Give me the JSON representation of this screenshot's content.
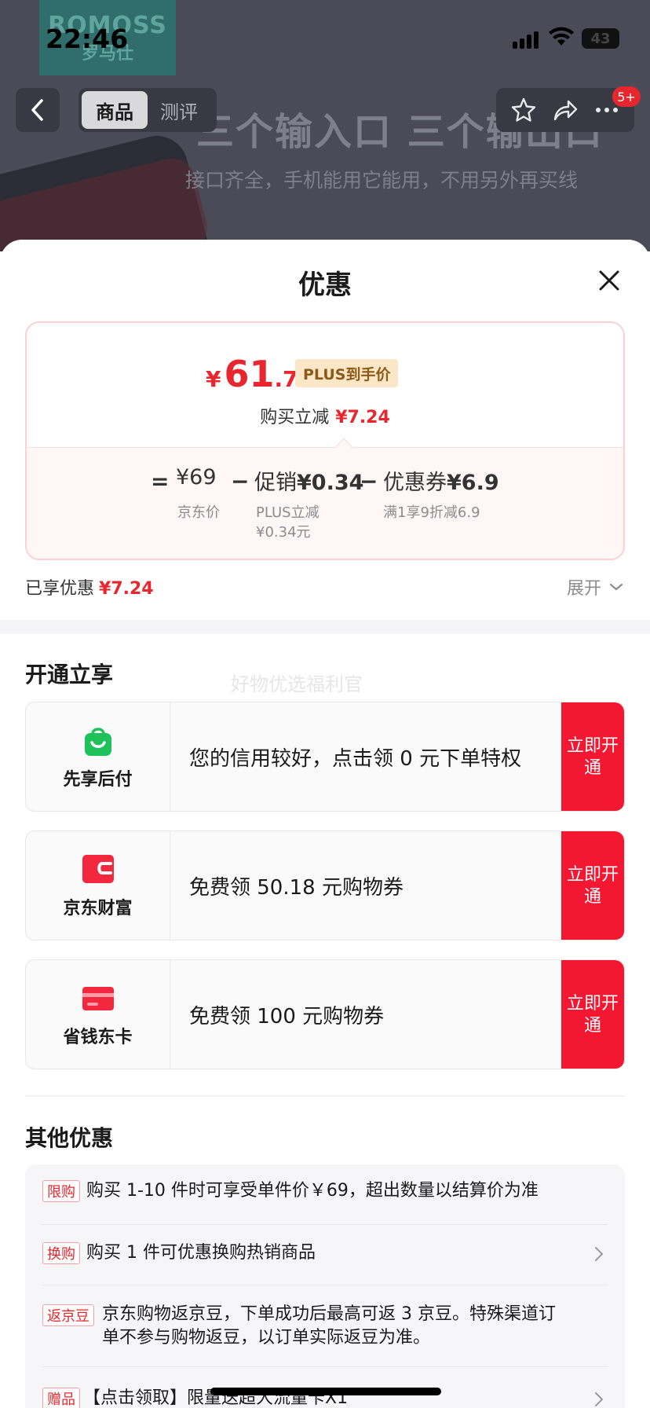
{
  "status": {
    "time": "22:46",
    "battery": "43"
  },
  "background": {
    "brand_en": "ROMOSS",
    "brand_cn": "罗马仕",
    "promo_title": "三个输入口 三个输出口",
    "promo_sub": "接口齐全，手机能用它能用，不用另外再买线"
  },
  "nav": {
    "tabs": [
      "商品",
      "测评"
    ],
    "badge": "5+"
  },
  "sheet": {
    "title": "优惠",
    "price": {
      "currency": "¥",
      "integer": "61",
      "decimal": ".76",
      "tag": "PLUS到手价",
      "reduce_label": "购买立减",
      "reduce_value": "¥7.24"
    },
    "breakdown": {
      "eq": "=",
      "base_value": "¥69",
      "base_note": "京东价",
      "minus": "−",
      "promo_label": "促销",
      "promo_value": "¥0.34",
      "promo_note_1": "PLUS立减",
      "promo_note_2": "¥0.34元",
      "coupon_label": "优惠券",
      "coupon_value": "¥6.9",
      "coupon_note": "满1享9折减6.9"
    },
    "enjoyed_label": "已享优惠",
    "enjoyed_value": "¥7.24",
    "expand_label": "展开",
    "open_title": "开通立享",
    "watermark": "好物优选福利官",
    "services": [
      {
        "name": "先享后付",
        "text": "您的信用较好，点击领 0 元下单特权",
        "btn": "立即开通",
        "color": "#1fc25a"
      },
      {
        "name": "京东财富",
        "text": "免费领 50.18 元购物券",
        "btn": "立即开通",
        "color": "#f3283e"
      },
      {
        "name": "省钱东卡",
        "text": "免费领 100 元购物券",
        "btn": "立即开通",
        "color": "#f3283e"
      }
    ],
    "other_title": "其他优惠",
    "others": [
      {
        "tag": "限购",
        "text": "购买 1-10 件时可享受单件价￥69，超出数量以结算价为准"
      },
      {
        "tag": "换购",
        "text": "购买 1 件可优惠换购热销商品"
      },
      {
        "tag": "返京豆",
        "text_1": "京东购物返京豆，下单成功后最高可返 3 京豆。特殊渠道订",
        "text_2": "单不参与购物返豆，以订单实际返豆为准。"
      },
      {
        "tag": "赠品",
        "text": "【点击领取】限量送超大流量卡X1"
      }
    ]
  }
}
